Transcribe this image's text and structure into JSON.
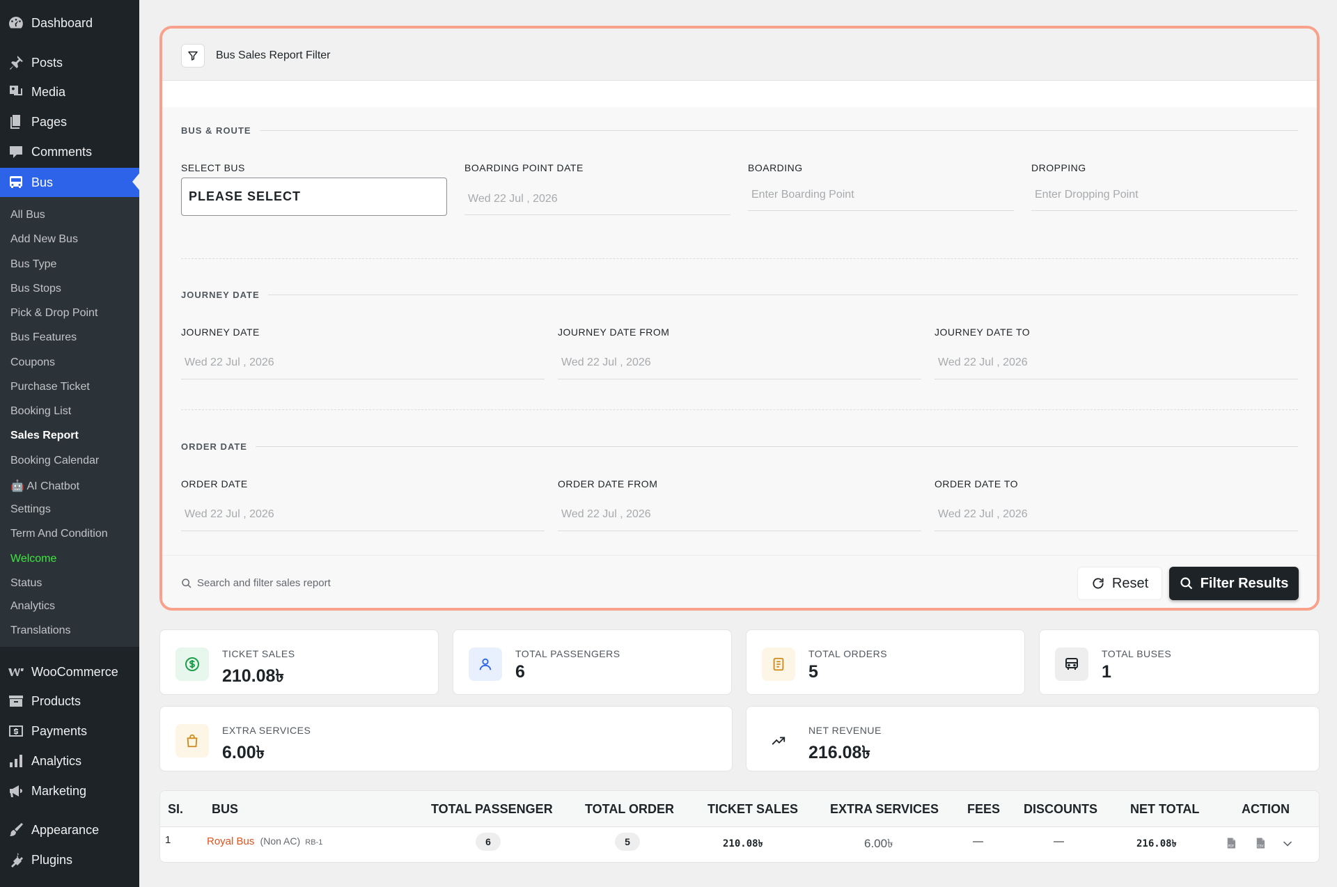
{
  "sidebar": {
    "top_items": [
      {
        "label": "Dashboard",
        "icon": "dashboard-icon"
      },
      {
        "label": "Posts",
        "icon": "pin-icon"
      },
      {
        "label": "Media",
        "icon": "media-icon"
      },
      {
        "label": "Pages",
        "icon": "pages-icon"
      },
      {
        "label": "Comments",
        "icon": "comment-icon"
      },
      {
        "label": "Bus",
        "icon": "bus-icon"
      }
    ],
    "sub_items": [
      "All Bus",
      "Add New Bus",
      "Bus Type",
      "Bus Stops",
      "Pick & Drop Point",
      "Bus Features",
      "Coupons",
      "Purchase Ticket",
      "Booking List",
      "Sales Report",
      "Booking Calendar",
      "🤖 AI Chatbot",
      "Settings",
      "Term And Condition",
      "Welcome",
      "Status",
      "Analytics",
      "Translations"
    ],
    "bottom_items": [
      {
        "label": "WooCommerce",
        "icon": "woocommerce-icon"
      },
      {
        "label": "Products",
        "icon": "products-icon"
      },
      {
        "label": "Payments",
        "icon": "payments-icon"
      },
      {
        "label": "Analytics",
        "icon": "analytics-icon"
      },
      {
        "label": "Marketing",
        "icon": "marketing-icon"
      },
      {
        "label": "Appearance",
        "icon": "appearance-icon"
      },
      {
        "label": "Plugins",
        "icon": "plugins-icon"
      }
    ],
    "accent_color": "#2c63e8"
  },
  "filter": {
    "title": "Bus Sales Report Filter",
    "sections": {
      "bus_route": "BUS & ROUTE",
      "journey_date": "JOURNEY DATE",
      "order_date": "ORDER DATE"
    },
    "bus_route": {
      "select_bus_label": "SELECT BUS",
      "select_bus_value": "PLEASE SELECT",
      "boarding_date_label": "BOARDING POINT DATE",
      "boarding_date_placeholder": "Wed 22 Jul , 2026",
      "boarding_label": "BOARDING",
      "boarding_placeholder": "Enter Boarding Point",
      "dropping_label": "DROPPING",
      "dropping_placeholder": "Enter Dropping Point"
    },
    "journey": {
      "date_label": "JOURNEY DATE",
      "date_placeholder": "Wed 22 Jul , 2026",
      "from_label": "JOURNEY DATE FROM",
      "from_placeholder": "Wed 22 Jul , 2026",
      "to_label": "JOURNEY DATE TO",
      "to_placeholder": "Wed 22 Jul , 2026"
    },
    "order": {
      "date_label": "ORDER DATE",
      "date_placeholder": "Wed 22 Jul , 2026",
      "from_label": "ORDER DATE FROM",
      "from_placeholder": "Wed 22 Jul , 2026",
      "to_label": "ORDER DATE TO",
      "to_placeholder": "Wed 22 Jul , 2026"
    },
    "search_hint": "Search and filter sales report",
    "reset_label": "Reset",
    "filter_label": "Filter Results",
    "border_color": "#f9a18a"
  },
  "stats": {
    "ticket_sales": {
      "label": "TICKET SALES",
      "value": "210.08৳",
      "color": "#1e9e4a"
    },
    "total_passengers": {
      "label": "TOTAL PASSENGERS",
      "value": "6",
      "color": "#2c63e8"
    },
    "total_orders": {
      "label": "TOTAL ORDERS",
      "value": "5",
      "color": "#d08a1a"
    },
    "total_buses": {
      "label": "TOTAL BUSES",
      "value": "1",
      "color": "#1d2327"
    },
    "extra_services": {
      "label": "EXTRA SERVICES",
      "value": "6.00৳",
      "color": "#d08a1a"
    },
    "net_revenue": {
      "label": "NET REVENUE",
      "value": "216.08৳",
      "color": "#1d2327"
    }
  },
  "table": {
    "headers": [
      "SI.",
      "BUS",
      "TOTAL PASSENGER",
      "TOTAL ORDER",
      "TICKET SALES",
      "EXTRA SERVICES",
      "FEES",
      "DISCOUNTS",
      "NET TOTAL",
      "ACTION"
    ],
    "rows": [
      {
        "si": "1",
        "bus_name": "Royal Bus",
        "bus_type": "(Non AC)",
        "bus_code": "RB-1",
        "passengers": "6",
        "orders": "5",
        "ticket_sales": "210.08৳",
        "extra_services": "6.00৳",
        "fees": "—",
        "discounts": "—",
        "net_total": "216.08৳"
      }
    ],
    "link_color": "#e0531f"
  }
}
